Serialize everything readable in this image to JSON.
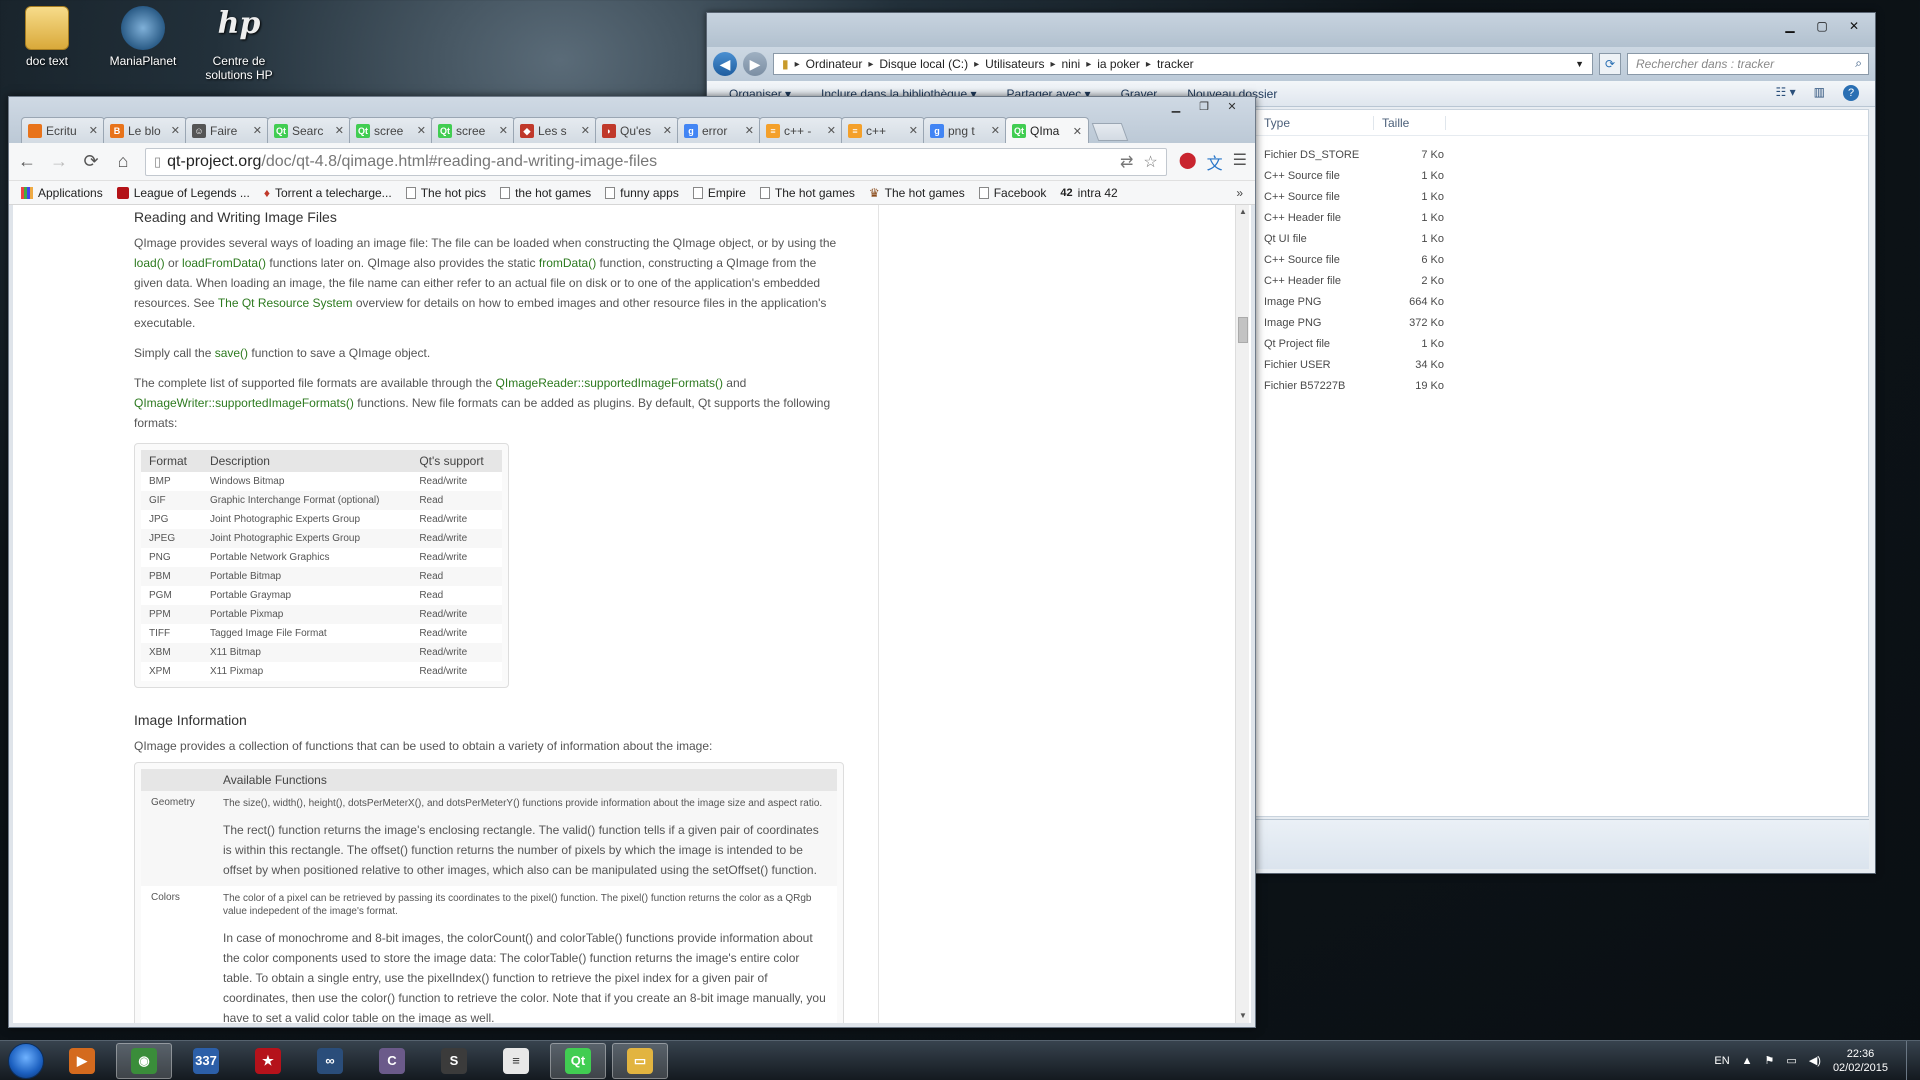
{
  "desktop": {
    "icons": [
      {
        "label": "doc text",
        "icon": "folder-icon"
      },
      {
        "label": "ManiaPlanet",
        "icon": "maniaplanet-icon"
      },
      {
        "label": "Centre de solutions HP",
        "icon": "hp-icon"
      }
    ]
  },
  "explorer": {
    "breadcrumbs": [
      "Ordinateur",
      "Disque local (C:)",
      "Utilisateurs",
      "nini",
      "ia poker",
      "tracker"
    ],
    "search_placeholder": "Rechercher dans : tracker",
    "commands": [
      "Organiser ▾",
      "Inclure dans la bibliothèque ▾",
      "Partager avec ▾",
      "Graver",
      "Nouveau dossier"
    ],
    "columns": {
      "type": "Type",
      "size": "Taille"
    },
    "files": [
      {
        "type": "Fichier DS_STORE",
        "size": "7 Ko"
      },
      {
        "type": "C++ Source file",
        "size": "1 Ko"
      },
      {
        "type": "C++ Source file",
        "size": "1 Ko"
      },
      {
        "type": "C++ Header file",
        "size": "1 Ko"
      },
      {
        "type": "Qt UI file",
        "size": "1 Ko"
      },
      {
        "type": "C++ Source file",
        "size": "6 Ko"
      },
      {
        "type": "C++ Header file",
        "size": "2 Ko"
      },
      {
        "type": "Image PNG",
        "size": "664 Ko"
      },
      {
        "type": "Image PNG",
        "size": "372 Ko"
      },
      {
        "type": "Qt Project file",
        "size": "1 Ko"
      },
      {
        "type": "Fichier USER",
        "size": "34 Ko"
      },
      {
        "type": "Fichier B57227B",
        "size": "19 Ko"
      }
    ]
  },
  "browser": {
    "tabs": [
      {
        "label": "Ecritu",
        "color": "#e8731a",
        "glyph": ""
      },
      {
        "label": "Le blo",
        "color": "#e8731a",
        "glyph": "B"
      },
      {
        "label": "Faire",
        "color": "#555555",
        "glyph": "☺"
      },
      {
        "label": "Searc",
        "color": "#41cd52",
        "glyph": "Qt"
      },
      {
        "label": "scree",
        "color": "#41cd52",
        "glyph": "Qt"
      },
      {
        "label": "scree",
        "color": "#41cd52",
        "glyph": "Qt"
      },
      {
        "label": "Les s",
        "color": "#c0392b",
        "glyph": "◆"
      },
      {
        "label": "Qu'es",
        "color": "#c0392b",
        "glyph": "◗"
      },
      {
        "label": "error",
        "color": "#4285f4",
        "glyph": "g"
      },
      {
        "label": "c++ -",
        "color": "#f4a02a",
        "glyph": "≡"
      },
      {
        "label": "c++",
        "color": "#f4a02a",
        "glyph": "≡"
      },
      {
        "label": "png t",
        "color": "#4285f4",
        "glyph": "g"
      },
      {
        "label": "QIma",
        "color": "#41cd52",
        "glyph": "Qt"
      }
    ],
    "url_host": "qt-project.org",
    "url_path": "/doc/qt-4.8/qimage.html#reading-and-writing-image-files",
    "bookmarks": [
      {
        "label": "Applications",
        "icon": "apps"
      },
      {
        "label": "League of Legends ...",
        "icon": "lol"
      },
      {
        "label": "Torrent a telecharge...",
        "icon": "tor"
      },
      {
        "label": "The hot pics",
        "icon": "page"
      },
      {
        "label": "the hot games",
        "icon": "page"
      },
      {
        "label": "funny apps",
        "icon": "page"
      },
      {
        "label": "Empire",
        "icon": "page"
      },
      {
        "label": "The hot games",
        "icon": "page"
      },
      {
        "label": "The hot games",
        "icon": "mario"
      },
      {
        "label": "Facebook",
        "icon": "page"
      },
      {
        "label": "intra 42",
        "icon": "42"
      }
    ]
  },
  "doc": {
    "section1_title": "Reading and Writing Image Files",
    "p1": [
      "QImage provides several ways of loading an image file: The file can be loaded when constructing the QImage object, or by using the ",
      "load()",
      " or ",
      "loadFromData()",
      " functions later on. QImage also provides the static ",
      "fromData()",
      " function, constructing a QImage from the given data. When loading an image, the file name can either refer to an actual file on disk or to one of the application's embedded resources. See ",
      "The Qt Resource System",
      " overview for details on how to embed images and other resource files in the application's executable."
    ],
    "p2": [
      "Simply call the ",
      "save()",
      " function to save a QImage object."
    ],
    "p3": [
      "The complete list of supported file formats are available through the ",
      "QImageReader::supportedImageFormats()",
      " and ",
      "QImageWriter::supportedImageFormats()",
      " functions. New file formats can be added as plugins. By default, Qt supports the following formats:"
    ],
    "formats_header": [
      "Format",
      "Description",
      "Qt's support"
    ],
    "formats": [
      [
        "BMP",
        "Windows Bitmap",
        "Read/write"
      ],
      [
        "GIF",
        "Graphic Interchange Format (optional)",
        "Read"
      ],
      [
        "JPG",
        "Joint Photographic Experts Group",
        "Read/write"
      ],
      [
        "JPEG",
        "Joint Photographic Experts Group",
        "Read/write"
      ],
      [
        "PNG",
        "Portable Network Graphics",
        "Read/write"
      ],
      [
        "PBM",
        "Portable Bitmap",
        "Read"
      ],
      [
        "PGM",
        "Portable Graymap",
        "Read"
      ],
      [
        "PPM",
        "Portable Pixmap",
        "Read/write"
      ],
      [
        "TIFF",
        "Tagged Image File Format",
        "Read/write"
      ],
      [
        "XBM",
        "X11 Bitmap",
        "Read/write"
      ],
      [
        "XPM",
        "X11 Pixmap",
        "Read/write"
      ]
    ],
    "section2_title": "Image Information",
    "p4": "QImage provides a collection of functions that can be used to obtain a variety of information about the image:",
    "info_header": "Available Functions",
    "geometry_label": "Geometry",
    "geometry_small": "The size(), width(), height(), dotsPerMeterX(), and dotsPerMeterY() functions provide information about the image size and aspect ratio.",
    "geometry_big": "The rect() function returns the image's enclosing rectangle. The valid() function tells if a given pair of coordinates is within this rectangle. The offset() function returns the number of pixels by which the image is intended to be offset by when positioned relative to other images, which also can be manipulated using the setOffset() function.",
    "colors_label": "Colors",
    "colors_small": "The color of a pixel can be retrieved by passing its coordinates to the pixel() function. The pixel() function returns the color as a QRgb value indepedent of the image's format.",
    "colors_big": "In case of monochrome and 8-bit images, the colorCount() and colorTable() functions provide information about the color components used to store the image data: The colorTable() function returns the image's entire color table. To obtain a single entry, use the pixelIndex() function to retrieve the pixel index for a given pair of coordinates, then use the color() function to retrieve the color. Note that if you create an 8-bit image manually, you have to set a valid color table on the image as well."
  },
  "taskbar": {
    "items": [
      {
        "name": "media-player-icon",
        "glyph": "▶",
        "bg": "#d46a1e"
      },
      {
        "name": "chrome-icon",
        "glyph": "◉",
        "bg": "#3a8d3a"
      },
      {
        "name": "app-337-icon",
        "glyph": "337",
        "bg": "#2c5fa8"
      },
      {
        "name": "poker-icon",
        "glyph": "★",
        "bg": "#b5121b"
      },
      {
        "name": "visual-studio-icon",
        "glyph": "∞",
        "bg": "#2a4d7a"
      },
      {
        "name": "app-c-icon",
        "glyph": "C",
        "bg": "#6b5a8a"
      },
      {
        "name": "sublime-icon",
        "glyph": "S",
        "bg": "#3b3b3b"
      },
      {
        "name": "notepad-icon",
        "glyph": "≡",
        "bg": "#e8e8e8"
      },
      {
        "name": "qt-creator-icon",
        "glyph": "Qt",
        "bg": "#41cd52"
      },
      {
        "name": "explorer-icon",
        "glyph": "▭",
        "bg": "#e2b440"
      }
    ],
    "lang": "EN",
    "time": "22:36",
    "date": "02/02/2015"
  }
}
